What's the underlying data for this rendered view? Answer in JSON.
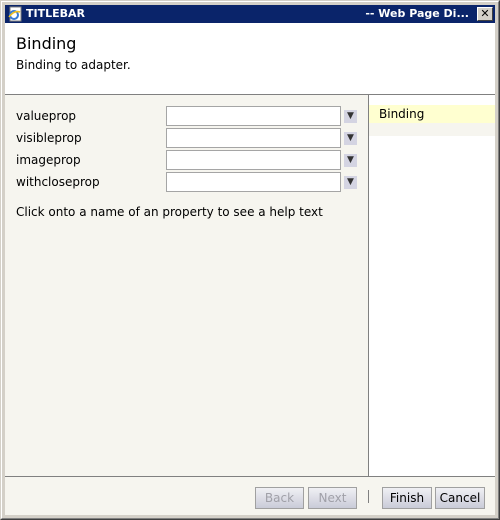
{
  "window": {
    "title_left": "TITLEBAR",
    "title_right": "-- Web Page Di...",
    "close_label": "✕"
  },
  "header": {
    "title": "Binding",
    "subtitle": "Binding to adapter."
  },
  "properties": [
    {
      "label": "valueprop",
      "value": ""
    },
    {
      "label": "visibleprop",
      "value": ""
    },
    {
      "label": "imageprop",
      "value": ""
    },
    {
      "label": "withcloseprop",
      "value": ""
    }
  ],
  "dropdown_glyph": "▼",
  "help_text": "Click onto a name of an property to see a help text",
  "nav": {
    "items": [
      {
        "label": "Binding",
        "selected": true
      }
    ]
  },
  "buttons": {
    "back": "Back",
    "next": "Next",
    "finish": "Finish",
    "cancel": "Cancel"
  }
}
